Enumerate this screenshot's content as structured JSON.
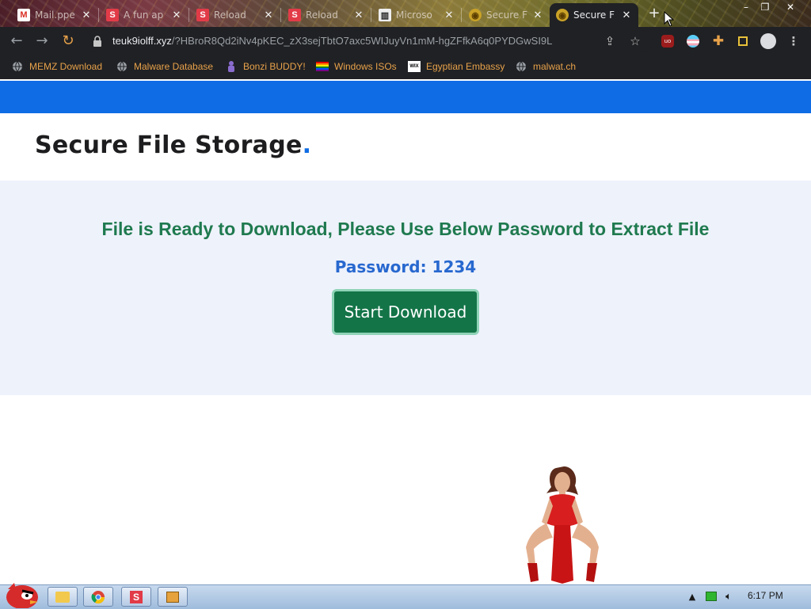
{
  "browser": {
    "tabs": [
      {
        "title": "Mail.ppe",
        "icon": "gmail-icon",
        "active": false
      },
      {
        "title": "A fun ap",
        "icon": "s-logo-icon",
        "active": false
      },
      {
        "title": "Reload",
        "icon": "s-logo-icon",
        "active": false
      },
      {
        "title": "Reload",
        "icon": "s-logo-icon",
        "active": false
      },
      {
        "title": "Microso",
        "icon": "trash-icon",
        "active": false
      },
      {
        "title": "Secure F",
        "icon": "globe-icon",
        "active": false
      },
      {
        "title": "Secure F",
        "icon": "globe-icon",
        "active": true
      }
    ],
    "new_tab": "+",
    "url_domain": "teuk9iolff.xyz",
    "url_path": "/?HBroR8Qd2iNv4pKEC_zX3sejTbtO7axc5WIJuyVn1mM-hgZFfkA6q0PYDGwSI9L",
    "bookmarks": [
      {
        "label": "MEMZ Download",
        "icon": "globe-icon"
      },
      {
        "label": "Malware Database",
        "icon": "globe-icon"
      },
      {
        "label": "Bonzi BUDDY!",
        "icon": "bonzi-icon"
      },
      {
        "label": "Windows ISOs",
        "icon": "rainbow-flag-icon"
      },
      {
        "label": "Egyptian Embassy",
        "icon": "wix-icon"
      },
      {
        "label": "malwat.ch",
        "icon": "globe-icon"
      }
    ]
  },
  "page": {
    "brand": "Secure File Storage",
    "brand_dot": ".",
    "headline": "File is Ready to Download, Please Use Below Password to Extract File",
    "password_text": "Password: 1234",
    "download_button": "Start Download"
  },
  "taskbar": {
    "clock": "6:17 PM",
    "apps": [
      "folder",
      "chrome",
      "s-app",
      "media-player"
    ]
  },
  "colors": {
    "accent_blue": "#0f6ce4",
    "headline_green": "#1f7a4f",
    "button_green": "#137447",
    "password_blue": "#2768cf",
    "panel_bg": "#eef2fb"
  }
}
